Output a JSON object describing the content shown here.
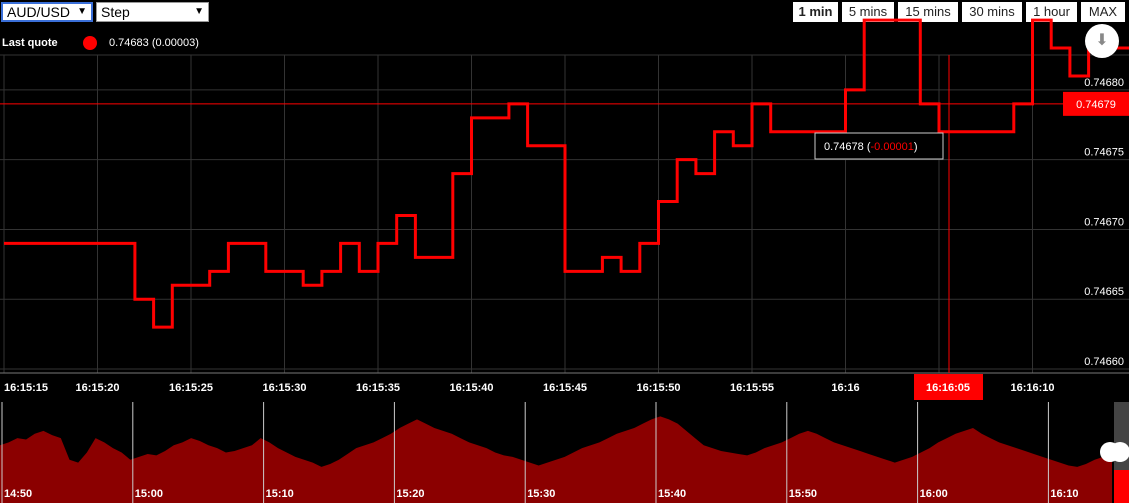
{
  "toolbar": {
    "pair": "AUD/USD",
    "mode": "Step",
    "timeframes": [
      "1 min",
      "5 mins",
      "15 mins",
      "30 mins",
      "1 hour",
      "MAX"
    ],
    "active_timeframe": "1 min"
  },
  "last_quote": {
    "label": "Last quote",
    "value": "0.74683 (0.00003)"
  },
  "icons": {
    "download": "download-icon",
    "dropdown": "chevron-down-icon"
  },
  "colors": {
    "series": "#ff0000",
    "navigator_fill": "#8b0000",
    "background": "#000000"
  },
  "chart_data": {
    "type": "line",
    "title": "",
    "xlabel": "",
    "ylabel": "",
    "ylim": [
      0.7466,
      0.74682
    ],
    "yticks": [
      "0.74660",
      "0.74665",
      "0.74670",
      "0.74675",
      "0.74680"
    ],
    "xticks": [
      "16:15:15",
      "16:15:20",
      "16:15:25",
      "16:15:30",
      "16:15:35",
      "16:15:40",
      "16:15:45",
      "16:15:50",
      "16:15:55",
      "16:16",
      "16:16:05",
      "16:16:10"
    ],
    "series": [
      {
        "values": [
          [
            0,
            0.74669
          ],
          [
            3,
            0.74669
          ],
          [
            7,
            0.74665
          ],
          [
            8,
            0.74663
          ],
          [
            9,
            0.74666
          ],
          [
            11,
            0.74667
          ],
          [
            12,
            0.74669
          ],
          [
            14,
            0.74667
          ],
          [
            16,
            0.74666
          ],
          [
            17,
            0.74667
          ],
          [
            18,
            0.74669
          ],
          [
            19,
            0.74667
          ],
          [
            20,
            0.74669
          ],
          [
            21,
            0.74671
          ],
          [
            22,
            0.74668
          ],
          [
            24,
            0.74674
          ],
          [
            25,
            0.74678
          ],
          [
            27,
            0.74679
          ],
          [
            28,
            0.74676
          ],
          [
            30,
            0.74667
          ],
          [
            32,
            0.74668
          ],
          [
            33,
            0.74667
          ],
          [
            34,
            0.74669
          ],
          [
            35,
            0.74672
          ],
          [
            36,
            0.74675
          ],
          [
            37,
            0.74674
          ],
          [
            38,
            0.74677
          ],
          [
            39,
            0.74676
          ],
          [
            40,
            0.74679
          ],
          [
            41,
            0.74677
          ],
          [
            45,
            0.7468
          ],
          [
            46,
            0.74685
          ],
          [
            49,
            0.74679
          ],
          [
            50,
            0.74677
          ],
          [
            54,
            0.74679
          ],
          [
            55,
            0.74685
          ],
          [
            56,
            0.74683
          ],
          [
            57,
            0.74681
          ],
          [
            58,
            0.74683
          ],
          [
            59,
            0.74683
          ]
        ]
      }
    ],
    "crosshair": {
      "time": "16:16:05",
      "value": "0.74678",
      "change": "-0.00001",
      "current_price": "0.74679"
    },
    "navigator": {
      "ticks": [
        "14:50",
        "15:00",
        "15:10",
        "15:20",
        "15:30",
        "15:40",
        "15:50",
        "16:00",
        "16:10"
      ],
      "values": [
        40,
        42,
        45,
        44,
        48,
        50,
        47,
        45,
        30,
        28,
        35,
        45,
        42,
        38,
        35,
        30,
        32,
        34,
        33,
        36,
        40,
        42,
        45,
        43,
        40,
        38,
        35,
        36,
        38,
        40,
        45,
        42,
        38,
        35,
        32,
        30,
        28,
        25,
        27,
        30,
        34,
        38,
        40,
        42,
        45,
        48,
        52,
        55,
        58,
        55,
        52,
        50,
        48,
        45,
        42,
        40,
        38,
        35,
        33,
        32,
        30,
        28,
        26,
        28,
        30,
        32,
        35,
        38,
        40,
        42,
        45,
        48,
        50,
        52,
        55,
        58,
        60,
        58,
        55,
        50,
        45,
        40,
        38,
        36,
        35,
        34,
        33,
        35,
        38,
        40,
        42,
        45,
        48,
        50,
        48,
        45,
        42,
        40,
        38,
        36,
        34,
        32,
        30,
        28,
        30,
        32,
        35,
        38,
        42,
        45,
        48,
        50,
        52,
        48,
        45,
        42,
        40,
        38,
        36,
        34,
        32,
        30,
        28,
        26,
        25,
        27,
        30,
        32,
        35
      ]
    }
  }
}
